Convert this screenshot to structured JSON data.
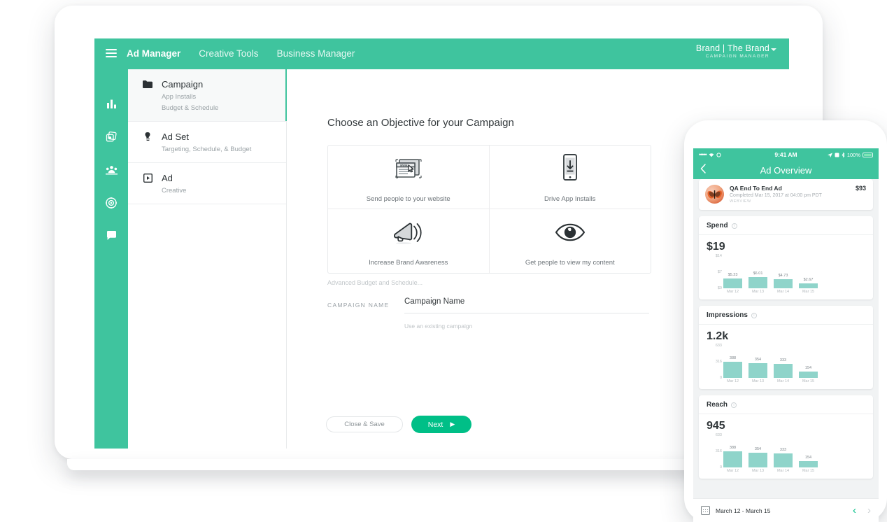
{
  "tablet": {
    "topnav": {
      "menu_icon": "hamburger-icon",
      "items": [
        {
          "label": "Ad Manager",
          "active": true
        },
        {
          "label": "Creative Tools",
          "active": false
        },
        {
          "label": "Business Manager",
          "active": false
        }
      ],
      "brand_name": "Brand | The Brand",
      "brand_role": "CAMPAIGN MANAGER"
    },
    "rail_icons": [
      "bar-chart-icon",
      "media-stack-icon",
      "audience-icon",
      "target-icon",
      "chat-bubble-icon"
    ],
    "steps": [
      {
        "icon": "folder-icon",
        "title": "Campaign",
        "subs": [
          "App Installs",
          "Budget & Schedule"
        ],
        "active": true
      },
      {
        "icon": "pin-icon",
        "title": "Ad Set",
        "subs": [
          "Targeting, Schedule, & Budget"
        ],
        "active": false
      },
      {
        "icon": "ad-frame-icon",
        "title": "Ad",
        "subs": [
          "Creative"
        ],
        "active": false
      }
    ],
    "main": {
      "title": "Choose an Objective for your Campaign",
      "objectives": [
        {
          "label": "Send people to your website",
          "icon": "browser-window-icon"
        },
        {
          "label": "Drive App Installs",
          "icon": "phone-download-icon"
        },
        {
          "label": "Increase Brand Awareness",
          "icon": "megaphone-icon"
        },
        {
          "label": "Get people to view my content",
          "icon": "eye-icon"
        }
      ],
      "advanced_link": "Advanced Budget and Schedule...",
      "campaign_label": "CAMPAIGN NAME",
      "campaign_value": "Campaign Name",
      "campaign_hint": "Use an existing campaign",
      "close_button": "Close & Save",
      "next_button": "Next"
    }
  },
  "phone": {
    "statusbar": {
      "signal_dots": "•••••",
      "wifi": "wifi-icon",
      "time": "9:41 AM",
      "battery_pct": "100%"
    },
    "navbar": {
      "back_icon": "chevron-left-icon",
      "title": "Ad Overview"
    },
    "ad": {
      "avatar": "butterfly-avatar",
      "title": "QA End To End Ad",
      "meta": "Completed Mar 15, 2017 at 04:00 pm PDT",
      "type": "WEBVIEW",
      "price": "$93"
    },
    "metrics": [
      {
        "name": "Spend",
        "total": "$19"
      },
      {
        "name": "Impressions",
        "total": "1.2k"
      },
      {
        "name": "Reach",
        "total": "945"
      }
    ],
    "footer": {
      "calendar_icon": "calendar-icon",
      "date_range": "March 12 - March 15",
      "prev": "‹",
      "next": "›"
    }
  },
  "chart_data": [
    {
      "type": "bar",
      "title": "Spend",
      "total": "$19",
      "categories": [
        "Mar 12",
        "Mar 13",
        "Mar 14",
        "Mar 15"
      ],
      "values": [
        5.23,
        6.01,
        4.73,
        2.67
      ],
      "value_labels": [
        "$5.23",
        "$6.01",
        "$4.73",
        "$2.67"
      ],
      "yticks": [
        "$14",
        "$7",
        "$0"
      ],
      "ylim": [
        0,
        14
      ],
      "xlabel": "",
      "ylabel": "",
      "grid": false,
      "legend": "none",
      "bar_color": "#8fd4ca"
    },
    {
      "type": "bar",
      "title": "Impressions",
      "total": "1.2k",
      "categories": [
        "Mar 12",
        "Mar 13",
        "Mar 14",
        "Mar 15"
      ],
      "values": [
        388,
        354,
        333,
        154
      ],
      "value_labels": [
        "388",
        "354",
        "333",
        "154"
      ],
      "yticks": [
        "633",
        "316",
        "0"
      ],
      "ylim": [
        0,
        633
      ],
      "xlabel": "",
      "ylabel": "",
      "grid": false,
      "legend": "none",
      "bar_color": "#8fd4ca"
    },
    {
      "type": "bar",
      "title": "Reach",
      "total": "945",
      "categories": [
        "Mar 12",
        "Mar 13",
        "Mar 14",
        "Mar 15"
      ],
      "values": [
        388,
        354,
        333,
        154
      ],
      "value_labels": [
        "388",
        "354",
        "333",
        "154"
      ],
      "yticks": [
        "633",
        "316",
        "0"
      ],
      "ylim": [
        0,
        633
      ],
      "xlabel": "",
      "ylabel": "",
      "grid": false,
      "legend": "none",
      "bar_color": "#8fd4ca"
    }
  ],
  "colors": {
    "brand_green": "#3fc49e",
    "accent_green": "#00bf87",
    "bar_teal": "#8fd4ca",
    "text_dark": "#2f3538",
    "text_muted": "#9aa2a6"
  }
}
